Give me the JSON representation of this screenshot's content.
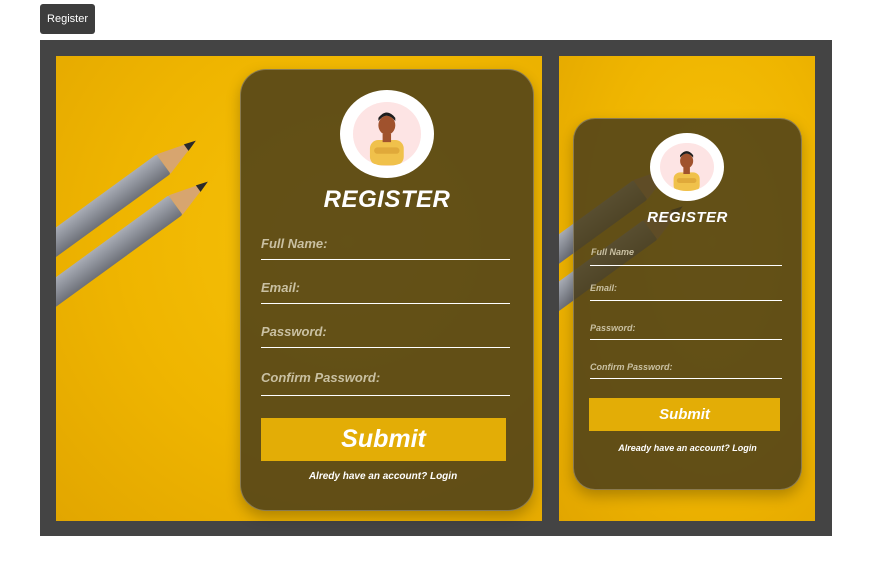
{
  "top_button": {
    "label": "Register"
  },
  "big_form": {
    "title": "REGISTER",
    "fields": [
      {
        "label": "Full Name:"
      },
      {
        "label": "Email:"
      },
      {
        "label": "Password:"
      },
      {
        "label": "Confirm Password:"
      }
    ],
    "submit_label": "Submit",
    "login_prompt": "Alredy have an account? Login"
  },
  "small_form": {
    "title": "REGISTER",
    "fields": [
      {
        "label": "Full Name"
      },
      {
        "label": "Email:"
      },
      {
        "label": "Password:"
      },
      {
        "label": "Confirm Password:"
      }
    ],
    "submit_label": "Submit",
    "login_prompt": "Already have an account? Login"
  },
  "colors": {
    "background": "#efb500",
    "card": "#4b3e1a",
    "accent": "#e3ad06",
    "frame": "#444444"
  },
  "icons": {
    "avatar": "user-avatar-icon"
  }
}
